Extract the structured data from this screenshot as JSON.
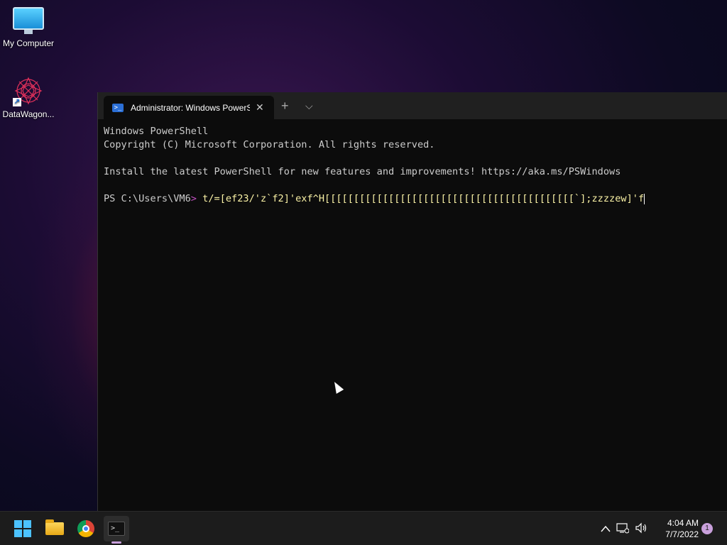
{
  "desktop": {
    "icons": [
      {
        "label": "My Computer",
        "icon": "computer-icon"
      },
      {
        "label": "DataWagon...",
        "icon": "datawagon-icon"
      }
    ]
  },
  "terminal": {
    "tab_title": "Administrator: Windows PowerS",
    "tab_icon": "powershell-icon",
    "new_tab": "+",
    "dropdown": "⌵",
    "lines": {
      "l1": "Windows PowerShell",
      "l2": "Copyright (C) Microsoft Corporation. All rights reserved.",
      "l3": "Install the latest PowerShell for new features and improvements! https://aka.ms/PSWindows",
      "prompt": "PS C:\\Users\\VM6",
      "prompt_symbol": ">",
      "command": " t/=[ef23/'z`f2]'exf^H[[[[[[[[[[[[[[[[[[[[[[[[[[[[[[[[[[[[[[[[[[[`];zzzzew]'f"
    }
  },
  "taskbar": {
    "apps": [
      "start-icon",
      "file-explorer-icon",
      "chrome-icon",
      "terminal-icon"
    ],
    "tray": {
      "chevron": "^",
      "network": "network-icon",
      "volume": "volume-icon"
    },
    "clock": {
      "time": "4:04 AM",
      "date": "7/7/2022"
    },
    "notification_count": "1"
  },
  "colors": {
    "accent": "#4cc2ff",
    "console_bg": "#0c0c0c",
    "command_text": "#f9f1a5"
  }
}
